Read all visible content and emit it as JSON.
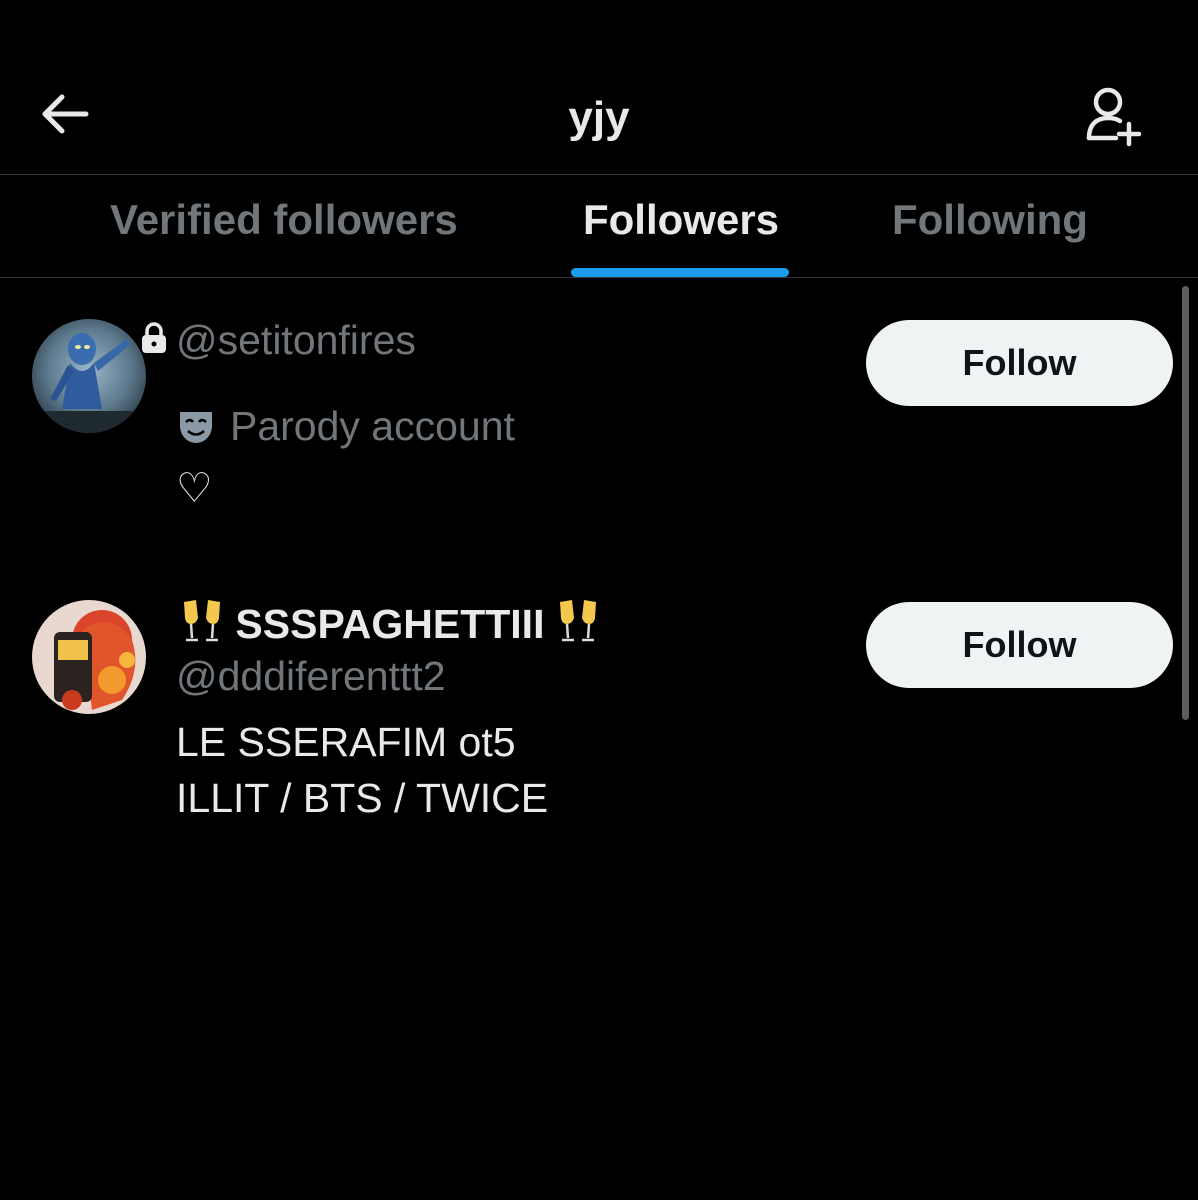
{
  "header": {
    "title": "yjy",
    "back_icon": "arrow-left-icon",
    "add_user_icon": "person-plus-icon"
  },
  "tabs": [
    {
      "label": "Verified followers",
      "active": false
    },
    {
      "label": "Followers",
      "active": true
    },
    {
      "label": "Following",
      "active": false
    }
  ],
  "colors": {
    "background": "#000000",
    "accent": "#1d9bf0",
    "primary_text": "#e7e9ea",
    "secondary_text": "#71767b",
    "button_bg": "#eff3f4"
  },
  "followers": [
    {
      "handle": "@setitonfires",
      "protected": true,
      "label": "Parody account",
      "bio": "♡",
      "follow_label": "Follow"
    },
    {
      "name": "SSSPAGHETTIII",
      "handle": "@dddiferenttt2",
      "bio_lines": [
        "LE SSERAFIM ot5",
        "ILLIT / BTS / TWICE"
      ],
      "follow_label": "Follow"
    }
  ]
}
